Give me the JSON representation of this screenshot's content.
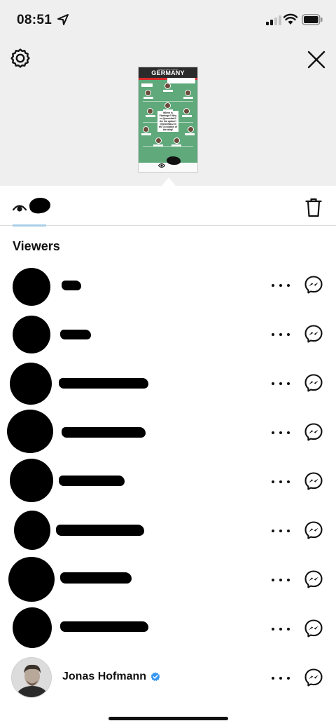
{
  "status_bar": {
    "time": "08:51",
    "icons": [
      "location-arrow-icon",
      "cellular-signal-icon",
      "wifi-icon",
      "battery-icon"
    ]
  },
  "header": {
    "settings_icon": "gear-icon",
    "close_icon": "close-icon"
  },
  "story_thumbnail": {
    "subtitle": "PREDICTED LINEUP",
    "title": "GERMANY",
    "note": "Where is Flamingo? Why is @jonnetta12 the 3rd option? @jonnetta12 in the 1st option of the wing!"
  },
  "tabs": {
    "viewers_icon": "eye-icon",
    "viewers_count": "",
    "delete_icon": "trash-icon"
  },
  "section": {
    "title": "Viewers"
  },
  "viewers": [
    {
      "name": "",
      "redacted": true
    },
    {
      "name": "",
      "redacted": true
    },
    {
      "name": "",
      "redacted": true
    },
    {
      "name": "",
      "redacted": true
    },
    {
      "name": "",
      "redacted": true
    },
    {
      "name": "",
      "redacted": true
    },
    {
      "name": "",
      "redacted": true
    },
    {
      "name": "",
      "redacted": true
    },
    {
      "name": "Jonas Hofmann",
      "redacted": false,
      "verified": true
    }
  ],
  "row_actions": {
    "more_icon": "more-horizontal-icon",
    "message_icon": "messenger-icon"
  },
  "colors": {
    "background": "#ffffff",
    "top_area": "#efefef",
    "tab_underline": "#a9cfe8",
    "verified_badge": "#3897f0"
  }
}
